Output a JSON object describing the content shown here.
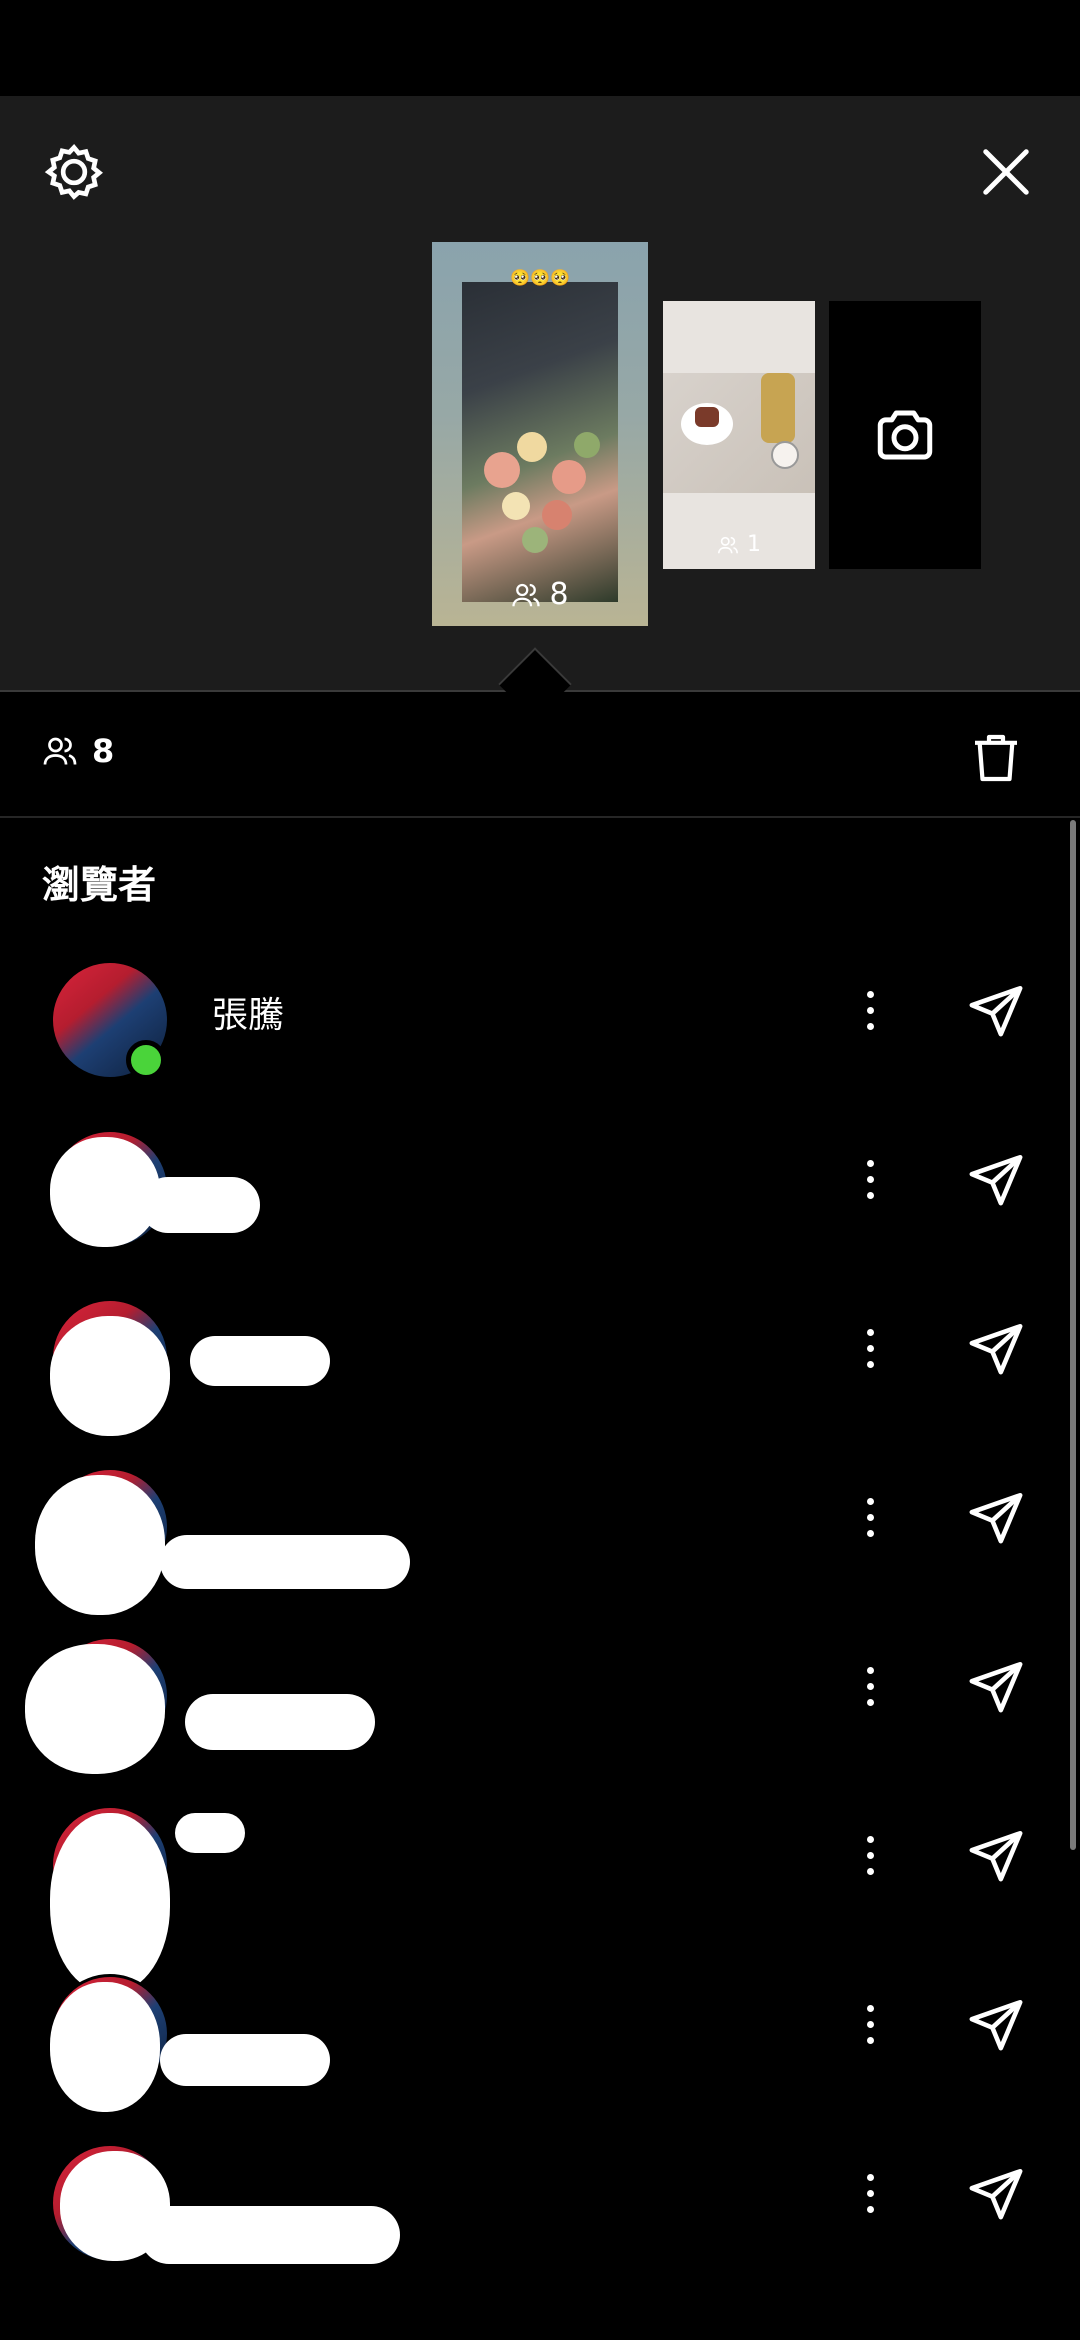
{
  "stories": {
    "main": {
      "emoji": "🥺🥺🥺",
      "viewer_count": "8"
    },
    "second": {
      "viewer_count": "1"
    }
  },
  "viewers": {
    "count": "8",
    "title": "瀏覽者",
    "items": [
      {
        "name": "張騰",
        "online": true,
        "redacted": false
      },
      {
        "name": "",
        "online": false,
        "redacted": true
      },
      {
        "name": "",
        "online": false,
        "redacted": true
      },
      {
        "name": "",
        "online": false,
        "redacted": true
      },
      {
        "name": "",
        "online": false,
        "redacted": true
      },
      {
        "name": "",
        "online": true,
        "redacted": true
      },
      {
        "name": "",
        "online": false,
        "redacted": true
      },
      {
        "name": "",
        "online": false,
        "redacted": true
      }
    ]
  },
  "colors": {
    "background": "#000000",
    "panel": "#1c1c1c",
    "online": "#4ad43a",
    "text": "#ffffff"
  },
  "icons": [
    "gear-icon",
    "close-icon",
    "camera-icon",
    "viewers-icon",
    "trash-icon",
    "more-icon",
    "send-icon"
  ]
}
